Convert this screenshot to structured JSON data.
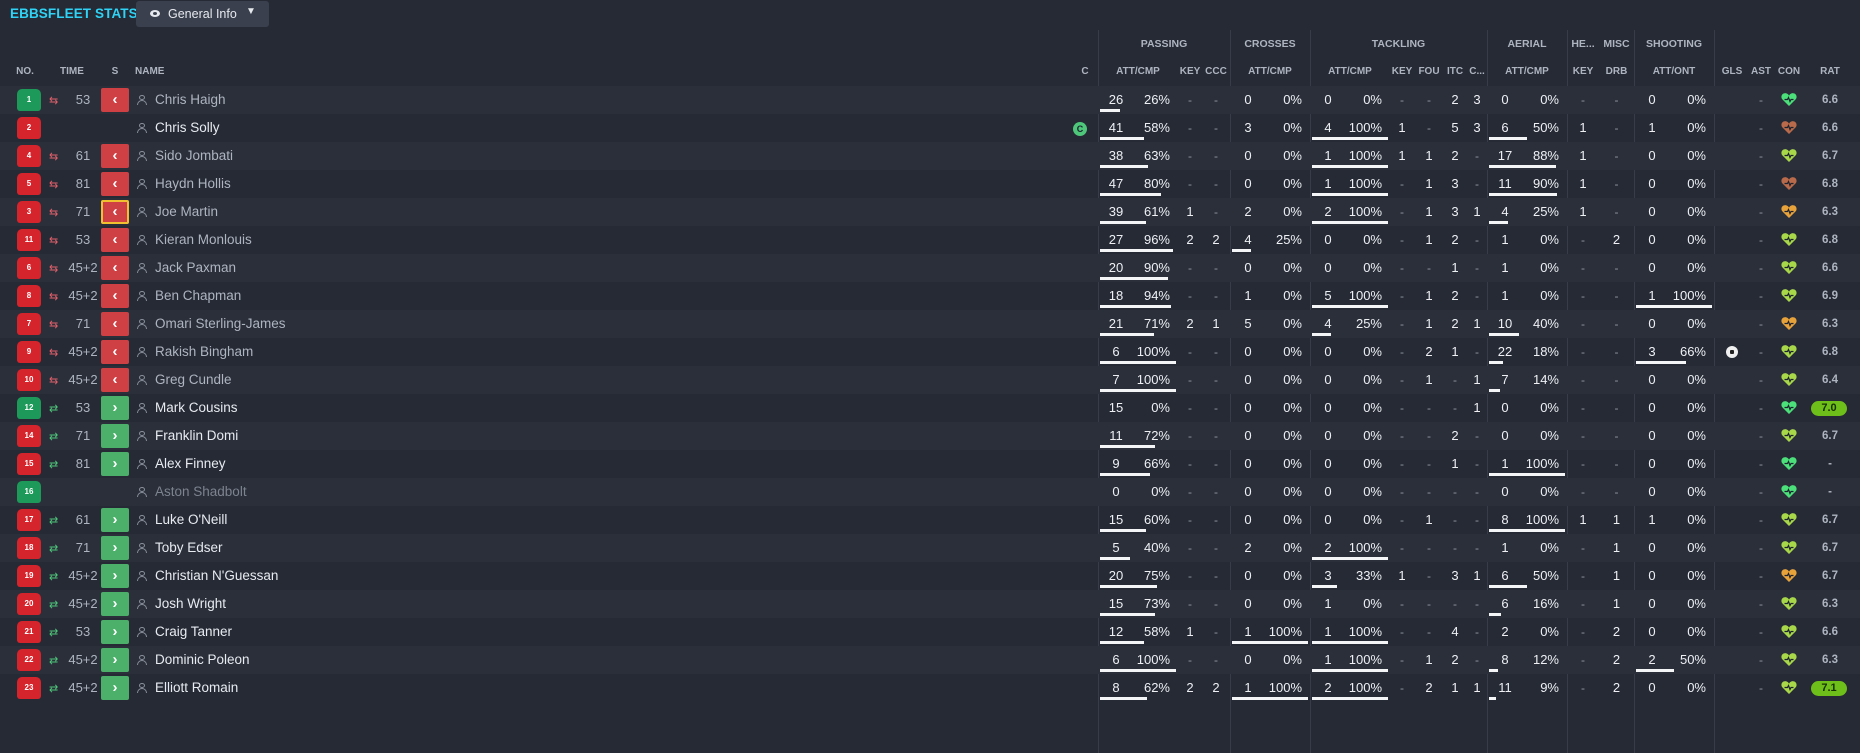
{
  "header": {
    "title": "EBBSFLEET STATS",
    "view_label": "General Info"
  },
  "group_headers": {
    "passing": "PASSING",
    "crosses": "CROSSES",
    "tackling": "TACKLING",
    "aerial": "AERIAL",
    "headers": "HE...",
    "misc": "MISC",
    "shooting": "SHOOTING"
  },
  "columns": {
    "no": "NO.",
    "time": "TIME",
    "s": "S",
    "name": "NAME",
    "c": "C",
    "pass_att_cmp": "ATT/CMP",
    "key": "KEY",
    "ccc": "CCC",
    "cross_att_cmp": "ATT/CMP",
    "tack_att_cmp": "ATT/CMP",
    "tack_key": "KEY",
    "fou": "FOU",
    "itc": "ITC",
    "clr": "C...",
    "aer_att_cmp": "ATT/CMP",
    "he_key": "KEY",
    "drb": "DRB",
    "shot_att_ont": "ATT/ONT",
    "gls": "GLS",
    "ast": "AST",
    "con": "CON",
    "rat": "RAT"
  },
  "colors": {
    "accent": "#2fd3f5",
    "sub_off": "#cf4045",
    "sub_on": "#4caf6a",
    "shirt_outfield": "#d5242c",
    "shirt_gk": "#1d9a5a",
    "rating_high": "#6fbf1a"
  },
  "players": [
    {
      "no": "1",
      "kit": "green",
      "sub": "off",
      "time": "53",
      "name": "Chris Haigh",
      "name_style": "played",
      "captain": "",
      "pass": [
        "26",
        "26%"
      ],
      "pass_fill": 0.26,
      "key": "-",
      "ccc": "-",
      "cross": [
        "0",
        "0%"
      ],
      "cross_fill": 0,
      "tack": [
        "0",
        "0%"
      ],
      "tack_fill": 0,
      "tkey": "-",
      "fou": "-",
      "itc": "2",
      "clr": "3",
      "aer": [
        "0",
        "0%"
      ],
      "aer_fill": 0,
      "hkey": "-",
      "drb": "-",
      "shot": [
        "0",
        "0%"
      ],
      "shot_fill": 0,
      "gls": "",
      "ast": "-",
      "con": "green",
      "rat": "6.6",
      "rat_pill": false
    },
    {
      "no": "2",
      "kit": "red",
      "sub": "",
      "time": "",
      "name": "Chris Solly",
      "name_style": "cur",
      "captain": "C",
      "pass": [
        "41",
        "58%"
      ],
      "pass_fill": 0.58,
      "key": "-",
      "ccc": "-",
      "cross": [
        "3",
        "0%"
      ],
      "cross_fill": 0,
      "tack": [
        "4",
        "100%"
      ],
      "tack_fill": 1,
      "tkey": "1",
      "fou": "-",
      "itc": "5",
      "clr": "3",
      "aer": [
        "6",
        "50%"
      ],
      "aer_fill": 0.5,
      "hkey": "1",
      "drb": "-",
      "shot": [
        "1",
        "0%"
      ],
      "shot_fill": 0,
      "gls": "",
      "ast": "-",
      "con": "brown",
      "rat": "6.6",
      "rat_pill": false
    },
    {
      "no": "4",
      "kit": "red",
      "sub": "off",
      "time": "61",
      "name": "Sido Jombati",
      "name_style": "played",
      "captain": "",
      "pass": [
        "38",
        "63%"
      ],
      "pass_fill": 0.63,
      "key": "-",
      "ccc": "-",
      "cross": [
        "0",
        "0%"
      ],
      "cross_fill": 0,
      "tack": [
        "1",
        "100%"
      ],
      "tack_fill": 1,
      "tkey": "1",
      "fou": "1",
      "itc": "2",
      "clr": "-",
      "aer": [
        "17",
        "88%"
      ],
      "aer_fill": 0.88,
      "hkey": "1",
      "drb": "-",
      "shot": [
        "0",
        "0%"
      ],
      "shot_fill": 0,
      "gls": "",
      "ast": "-",
      "con": "lime",
      "rat": "6.7",
      "rat_pill": false
    },
    {
      "no": "5",
      "kit": "red",
      "sub": "off",
      "time": "81",
      "name": "Haydn Hollis",
      "name_style": "played",
      "captain": "",
      "pass": [
        "47",
        "80%"
      ],
      "pass_fill": 0.8,
      "key": "-",
      "ccc": "-",
      "cross": [
        "0",
        "0%"
      ],
      "cross_fill": 0,
      "tack": [
        "1",
        "100%"
      ],
      "tack_fill": 1,
      "tkey": "-",
      "fou": "1",
      "itc": "3",
      "clr": "-",
      "aer": [
        "11",
        "90%"
      ],
      "aer_fill": 0.9,
      "hkey": "1",
      "drb": "-",
      "shot": [
        "0",
        "0%"
      ],
      "shot_fill": 0,
      "gls": "",
      "ast": "-",
      "con": "brown",
      "rat": "6.8",
      "rat_pill": false
    },
    {
      "no": "3",
      "kit": "red",
      "sub": "off-sel",
      "time": "71",
      "name": "Joe Martin",
      "name_style": "played",
      "captain": "",
      "pass": [
        "39",
        "61%"
      ],
      "pass_fill": 0.61,
      "key": "1",
      "ccc": "-",
      "cross": [
        "2",
        "0%"
      ],
      "cross_fill": 0,
      "tack": [
        "2",
        "100%"
      ],
      "tack_fill": 1,
      "tkey": "-",
      "fou": "1",
      "itc": "3",
      "clr": "1",
      "aer": [
        "4",
        "25%"
      ],
      "aer_fill": 0.25,
      "hkey": "1",
      "drb": "-",
      "shot": [
        "0",
        "0%"
      ],
      "shot_fill": 0,
      "gls": "",
      "ast": "-",
      "con": "orange",
      "rat": "6.3",
      "rat_pill": false
    },
    {
      "no": "11",
      "kit": "red",
      "sub": "off",
      "time": "53",
      "name": "Kieran Monlouis",
      "name_style": "played",
      "captain": "",
      "pass": [
        "27",
        "96%"
      ],
      "pass_fill": 0.96,
      "key": "2",
      "ccc": "2",
      "cross": [
        "4",
        "25%"
      ],
      "cross_fill": 0.25,
      "tack": [
        "0",
        "0%"
      ],
      "tack_fill": 0,
      "tkey": "-",
      "fou": "1",
      "itc": "2",
      "clr": "-",
      "aer": [
        "1",
        "0%"
      ],
      "aer_fill": 0,
      "hkey": "-",
      "drb": "2",
      "shot": [
        "0",
        "0%"
      ],
      "shot_fill": 0,
      "gls": "",
      "ast": "-",
      "con": "lime",
      "rat": "6.8",
      "rat_pill": false
    },
    {
      "no": "6",
      "kit": "red",
      "sub": "off",
      "time": "45+2",
      "name": "Jack Paxman",
      "name_style": "played",
      "captain": "",
      "pass": [
        "20",
        "90%"
      ],
      "pass_fill": 0.9,
      "key": "-",
      "ccc": "-",
      "cross": [
        "0",
        "0%"
      ],
      "cross_fill": 0,
      "tack": [
        "0",
        "0%"
      ],
      "tack_fill": 0,
      "tkey": "-",
      "fou": "-",
      "itc": "1",
      "clr": "-",
      "aer": [
        "1",
        "0%"
      ],
      "aer_fill": 0,
      "hkey": "-",
      "drb": "-",
      "shot": [
        "0",
        "0%"
      ],
      "shot_fill": 0,
      "gls": "",
      "ast": "-",
      "con": "lime",
      "rat": "6.6",
      "rat_pill": false
    },
    {
      "no": "8",
      "kit": "red",
      "sub": "off",
      "time": "45+2",
      "name": "Ben Chapman",
      "name_style": "played",
      "captain": "",
      "pass": [
        "18",
        "94%"
      ],
      "pass_fill": 0.94,
      "key": "-",
      "ccc": "-",
      "cross": [
        "1",
        "0%"
      ],
      "cross_fill": 0,
      "tack": [
        "5",
        "100%"
      ],
      "tack_fill": 1,
      "tkey": "-",
      "fou": "1",
      "itc": "2",
      "clr": "-",
      "aer": [
        "1",
        "0%"
      ],
      "aer_fill": 0,
      "hkey": "-",
      "drb": "-",
      "shot": [
        "1",
        "100%"
      ],
      "shot_fill": 1,
      "gls": "",
      "ast": "-",
      "con": "lime",
      "rat": "6.9",
      "rat_pill": false
    },
    {
      "no": "7",
      "kit": "red",
      "sub": "off",
      "time": "71",
      "name": "Omari Sterling-James",
      "name_style": "played",
      "captain": "",
      "pass": [
        "21",
        "71%"
      ],
      "pass_fill": 0.71,
      "key": "2",
      "ccc": "1",
      "cross": [
        "5",
        "0%"
      ],
      "cross_fill": 0,
      "tack": [
        "4",
        "25%"
      ],
      "tack_fill": 0.25,
      "tkey": "-",
      "fou": "1",
      "itc": "2",
      "clr": "1",
      "aer": [
        "10",
        "40%"
      ],
      "aer_fill": 0.4,
      "hkey": "-",
      "drb": "-",
      "shot": [
        "0",
        "0%"
      ],
      "shot_fill": 0,
      "gls": "",
      "ast": "-",
      "con": "orange",
      "rat": "6.3",
      "rat_pill": false
    },
    {
      "no": "9",
      "kit": "red",
      "sub": "off",
      "time": "45+2",
      "name": "Rakish Bingham",
      "name_style": "played",
      "captain": "",
      "pass": [
        "6",
        "100%"
      ],
      "pass_fill": 1,
      "key": "-",
      "ccc": "-",
      "cross": [
        "0",
        "0%"
      ],
      "cross_fill": 0,
      "tack": [
        "0",
        "0%"
      ],
      "tack_fill": 0,
      "tkey": "-",
      "fou": "2",
      "itc": "1",
      "clr": "-",
      "aer": [
        "22",
        "18%"
      ],
      "aer_fill": 0.18,
      "hkey": "-",
      "drb": "-",
      "shot": [
        "3",
        "66%"
      ],
      "shot_fill": 0.66,
      "gls": "ball",
      "ast": "-",
      "con": "lime",
      "rat": "6.8",
      "rat_pill": false
    },
    {
      "no": "10",
      "kit": "red",
      "sub": "off",
      "time": "45+2",
      "name": "Greg Cundle",
      "name_style": "played",
      "captain": "",
      "pass": [
        "7",
        "100%"
      ],
      "pass_fill": 1,
      "key": "-",
      "ccc": "-",
      "cross": [
        "0",
        "0%"
      ],
      "cross_fill": 0,
      "tack": [
        "0",
        "0%"
      ],
      "tack_fill": 0,
      "tkey": "-",
      "fou": "1",
      "itc": "-",
      "clr": "1",
      "aer": [
        "7",
        "14%"
      ],
      "aer_fill": 0.14,
      "hkey": "-",
      "drb": "-",
      "shot": [
        "0",
        "0%"
      ],
      "shot_fill": 0,
      "gls": "",
      "ast": "-",
      "con": "lime",
      "rat": "6.4",
      "rat_pill": false
    },
    {
      "no": "12",
      "kit": "green",
      "sub": "on",
      "time": "53",
      "name": "Mark Cousins",
      "name_style": "cur",
      "captain": "",
      "pass": [
        "15",
        "0%"
      ],
      "pass_fill": 0,
      "key": "-",
      "ccc": "-",
      "cross": [
        "0",
        "0%"
      ],
      "cross_fill": 0,
      "tack": [
        "0",
        "0%"
      ],
      "tack_fill": 0,
      "tkey": "-",
      "fou": "-",
      "itc": "-",
      "clr": "1",
      "aer": [
        "0",
        "0%"
      ],
      "aer_fill": 0,
      "hkey": "-",
      "drb": "-",
      "shot": [
        "0",
        "0%"
      ],
      "shot_fill": 0,
      "gls": "",
      "ast": "-",
      "con": "green",
      "rat": "7.0",
      "rat_pill": true
    },
    {
      "no": "14",
      "kit": "red",
      "sub": "on",
      "time": "71",
      "name": "Franklin Domi",
      "name_style": "cur",
      "captain": "",
      "pass": [
        "11",
        "72%"
      ],
      "pass_fill": 0.72,
      "key": "-",
      "ccc": "-",
      "cross": [
        "0",
        "0%"
      ],
      "cross_fill": 0,
      "tack": [
        "0",
        "0%"
      ],
      "tack_fill": 0,
      "tkey": "-",
      "fou": "-",
      "itc": "2",
      "clr": "-",
      "aer": [
        "0",
        "0%"
      ],
      "aer_fill": 0,
      "hkey": "-",
      "drb": "-",
      "shot": [
        "0",
        "0%"
      ],
      "shot_fill": 0,
      "gls": "",
      "ast": "-",
      "con": "lime",
      "rat": "6.7",
      "rat_pill": false
    },
    {
      "no": "15",
      "kit": "red",
      "sub": "on",
      "time": "81",
      "name": "Alex Finney",
      "name_style": "cur",
      "captain": "",
      "pass": [
        "9",
        "66%"
      ],
      "pass_fill": 0.66,
      "key": "-",
      "ccc": "-",
      "cross": [
        "0",
        "0%"
      ],
      "cross_fill": 0,
      "tack": [
        "0",
        "0%"
      ],
      "tack_fill": 0,
      "tkey": "-",
      "fou": "-",
      "itc": "1",
      "clr": "-",
      "aer": [
        "1",
        "100%"
      ],
      "aer_fill": 1,
      "hkey": "-",
      "drb": "-",
      "shot": [
        "0",
        "0%"
      ],
      "shot_fill": 0,
      "gls": "",
      "ast": "-",
      "con": "green",
      "rat": "-",
      "rat_pill": false
    },
    {
      "no": "16",
      "kit": "green",
      "sub": "",
      "time": "",
      "name": "Aston Shadbolt",
      "name_style": "dim",
      "captain": "",
      "pass": [
        "0",
        "0%"
      ],
      "pass_fill": 0,
      "key": "-",
      "ccc": "-",
      "cross": [
        "0",
        "0%"
      ],
      "cross_fill": 0,
      "tack": [
        "0",
        "0%"
      ],
      "tack_fill": 0,
      "tkey": "-",
      "fou": "-",
      "itc": "-",
      "clr": "-",
      "aer": [
        "0",
        "0%"
      ],
      "aer_fill": 0,
      "hkey": "-",
      "drb": "-",
      "shot": [
        "0",
        "0%"
      ],
      "shot_fill": 0,
      "gls": "",
      "ast": "-",
      "con": "green",
      "rat": "-",
      "rat_pill": false
    },
    {
      "no": "17",
      "kit": "red",
      "sub": "on",
      "time": "61",
      "name": "Luke O'Neill",
      "name_style": "cur",
      "captain": "",
      "pass": [
        "15",
        "60%"
      ],
      "pass_fill": 0.6,
      "key": "-",
      "ccc": "-",
      "cross": [
        "0",
        "0%"
      ],
      "cross_fill": 0,
      "tack": [
        "0",
        "0%"
      ],
      "tack_fill": 0,
      "tkey": "-",
      "fou": "1",
      "itc": "-",
      "clr": "-",
      "aer": [
        "8",
        "100%"
      ],
      "aer_fill": 1,
      "hkey": "1",
      "drb": "1",
      "shot": [
        "1",
        "0%"
      ],
      "shot_fill": 0,
      "gls": "",
      "ast": "-",
      "con": "lime",
      "rat": "6.7",
      "rat_pill": false
    },
    {
      "no": "18",
      "kit": "red",
      "sub": "on",
      "time": "71",
      "name": "Toby Edser",
      "name_style": "cur",
      "captain": "",
      "pass": [
        "5",
        "40%"
      ],
      "pass_fill": 0.4,
      "key": "-",
      "ccc": "-",
      "cross": [
        "2",
        "0%"
      ],
      "cross_fill": 0,
      "tack": [
        "2",
        "100%"
      ],
      "tack_fill": 1,
      "tkey": "-",
      "fou": "-",
      "itc": "-",
      "clr": "-",
      "aer": [
        "1",
        "0%"
      ],
      "aer_fill": 0,
      "hkey": "-",
      "drb": "1",
      "shot": [
        "0",
        "0%"
      ],
      "shot_fill": 0,
      "gls": "",
      "ast": "-",
      "con": "lime",
      "rat": "6.7",
      "rat_pill": false
    },
    {
      "no": "19",
      "kit": "red",
      "sub": "on",
      "time": "45+2",
      "name": "Christian N'Guessan",
      "name_style": "cur",
      "captain": "",
      "pass": [
        "20",
        "75%"
      ],
      "pass_fill": 0.75,
      "key": "-",
      "ccc": "-",
      "cross": [
        "0",
        "0%"
      ],
      "cross_fill": 0,
      "tack": [
        "3",
        "33%"
      ],
      "tack_fill": 0.33,
      "tkey": "1",
      "fou": "-",
      "itc": "3",
      "clr": "1",
      "aer": [
        "6",
        "50%"
      ],
      "aer_fill": 0.5,
      "hkey": "-",
      "drb": "1",
      "shot": [
        "0",
        "0%"
      ],
      "shot_fill": 0,
      "gls": "",
      "ast": "-",
      "con": "orange",
      "rat": "6.7",
      "rat_pill": false
    },
    {
      "no": "20",
      "kit": "red",
      "sub": "on",
      "time": "45+2",
      "name": "Josh Wright",
      "name_style": "cur",
      "captain": "",
      "pass": [
        "15",
        "73%"
      ],
      "pass_fill": 0.73,
      "key": "-",
      "ccc": "-",
      "cross": [
        "0",
        "0%"
      ],
      "cross_fill": 0,
      "tack": [
        "1",
        "0%"
      ],
      "tack_fill": 0,
      "tkey": "-",
      "fou": "-",
      "itc": "-",
      "clr": "-",
      "aer": [
        "6",
        "16%"
      ],
      "aer_fill": 0.16,
      "hkey": "-",
      "drb": "1",
      "shot": [
        "0",
        "0%"
      ],
      "shot_fill": 0,
      "gls": "",
      "ast": "-",
      "con": "lime",
      "rat": "6.3",
      "rat_pill": false
    },
    {
      "no": "21",
      "kit": "red",
      "sub": "on",
      "time": "53",
      "name": "Craig Tanner",
      "name_style": "cur",
      "captain": "",
      "pass": [
        "12",
        "58%"
      ],
      "pass_fill": 0.58,
      "key": "1",
      "ccc": "-",
      "cross": [
        "1",
        "100%"
      ],
      "cross_fill": 1,
      "tack": [
        "1",
        "100%"
      ],
      "tack_fill": 1,
      "tkey": "-",
      "fou": "-",
      "itc": "4",
      "clr": "-",
      "aer": [
        "2",
        "0%"
      ],
      "aer_fill": 0,
      "hkey": "-",
      "drb": "2",
      "shot": [
        "0",
        "0%"
      ],
      "shot_fill": 0,
      "gls": "",
      "ast": "-",
      "con": "lime",
      "rat": "6.6",
      "rat_pill": false
    },
    {
      "no": "22",
      "kit": "red",
      "sub": "on",
      "time": "45+2",
      "name": "Dominic Poleon",
      "name_style": "cur",
      "captain": "",
      "pass": [
        "6",
        "100%"
      ],
      "pass_fill": 1,
      "key": "-",
      "ccc": "-",
      "cross": [
        "0",
        "0%"
      ],
      "cross_fill": 0,
      "tack": [
        "1",
        "100%"
      ],
      "tack_fill": 1,
      "tkey": "-",
      "fou": "1",
      "itc": "2",
      "clr": "-",
      "aer": [
        "8",
        "12%"
      ],
      "aer_fill": 0.12,
      "hkey": "-",
      "drb": "2",
      "shot": [
        "2",
        "50%"
      ],
      "shot_fill": 0.5,
      "gls": "",
      "ast": "-",
      "con": "lime",
      "rat": "6.3",
      "rat_pill": false
    },
    {
      "no": "23",
      "kit": "red",
      "sub": "on",
      "time": "45+2",
      "name": "Elliott Romain",
      "name_style": "cur",
      "captain": "",
      "pass": [
        "8",
        "62%"
      ],
      "pass_fill": 0.62,
      "key": "2",
      "ccc": "2",
      "cross": [
        "1",
        "100%"
      ],
      "cross_fill": 1,
      "tack": [
        "2",
        "100%"
      ],
      "tack_fill": 1,
      "tkey": "-",
      "fou": "2",
      "itc": "1",
      "clr": "1",
      "aer": [
        "11",
        "9%"
      ],
      "aer_fill": 0.09,
      "hkey": "-",
      "drb": "2",
      "shot": [
        "0",
        "0%"
      ],
      "shot_fill": 0,
      "gls": "",
      "ast": "-",
      "con": "lime",
      "rat": "7.1",
      "rat_pill": true
    }
  ]
}
